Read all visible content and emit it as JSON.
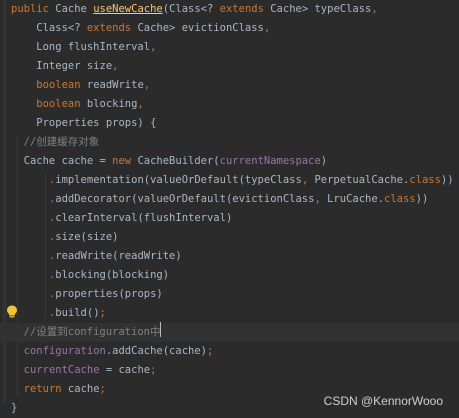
{
  "code": {
    "lines": [
      [
        {
          "t": "public ",
          "c": "kw"
        },
        {
          "t": "Cache ",
          "c": "text"
        },
        {
          "t": "useNewCache",
          "c": "fn-hl"
        },
        {
          "t": "(Class<? ",
          "c": "text"
        },
        {
          "t": "extends ",
          "c": "kw"
        },
        {
          "t": "Cache> typeClass",
          "c": "text"
        },
        {
          "t": ",",
          "c": "kw"
        }
      ],
      [
        {
          "t": "    Class<? ",
          "c": "text"
        },
        {
          "t": "extends ",
          "c": "kw"
        },
        {
          "t": "Cache> evictionClass",
          "c": "text"
        },
        {
          "t": ",",
          "c": "kw"
        }
      ],
      [
        {
          "t": "    Long flushInterval",
          "c": "text"
        },
        {
          "t": ",",
          "c": "kw"
        }
      ],
      [
        {
          "t": "    Integer size",
          "c": "text"
        },
        {
          "t": ",",
          "c": "kw"
        }
      ],
      [
        {
          "t": "    ",
          "c": "text"
        },
        {
          "t": "boolean ",
          "c": "kw"
        },
        {
          "t": "readWrite",
          "c": "text"
        },
        {
          "t": ",",
          "c": "kw"
        }
      ],
      [
        {
          "t": "    ",
          "c": "text"
        },
        {
          "t": "boolean ",
          "c": "kw"
        },
        {
          "t": "blocking",
          "c": "text"
        },
        {
          "t": ",",
          "c": "kw"
        }
      ],
      [
        {
          "t": "    Properties props) {",
          "c": "text"
        }
      ],
      [
        {
          "t": "  //创建缓存对象",
          "c": "comment"
        }
      ],
      [
        {
          "t": "  Cache cache = ",
          "c": "text"
        },
        {
          "t": "new ",
          "c": "kw"
        },
        {
          "t": "CacheBuilder(",
          "c": "text"
        },
        {
          "t": "currentNamespace",
          "c": "field"
        },
        {
          "t": ")",
          "c": "text"
        }
      ],
      [
        {
          "t": "      ",
          "c": "text"
        },
        {
          "t": ".",
          "c": "dot"
        },
        {
          "t": "implementation(valueOrDefault(typeClass",
          "c": "text"
        },
        {
          "t": ", ",
          "c": "kw"
        },
        {
          "t": "PerpetualCache.",
          "c": "text"
        },
        {
          "t": "class",
          "c": "kw"
        },
        {
          "t": "))",
          "c": "text"
        }
      ],
      [
        {
          "t": "      ",
          "c": "text"
        },
        {
          "t": ".",
          "c": "dot"
        },
        {
          "t": "addDecorator(valueOrDefault(evictionClass",
          "c": "text"
        },
        {
          "t": ", ",
          "c": "kw"
        },
        {
          "t": "LruCache.",
          "c": "text"
        },
        {
          "t": "class",
          "c": "kw"
        },
        {
          "t": "))",
          "c": "text"
        }
      ],
      [
        {
          "t": "      ",
          "c": "text"
        },
        {
          "t": ".",
          "c": "dot"
        },
        {
          "t": "clearInterval(flushInterval)",
          "c": "text"
        }
      ],
      [
        {
          "t": "      ",
          "c": "text"
        },
        {
          "t": ".",
          "c": "dot"
        },
        {
          "t": "size(size)",
          "c": "text"
        }
      ],
      [
        {
          "t": "      ",
          "c": "text"
        },
        {
          "t": ".",
          "c": "dot"
        },
        {
          "t": "readWrite(readWrite)",
          "c": "text"
        }
      ],
      [
        {
          "t": "      ",
          "c": "text"
        },
        {
          "t": ".",
          "c": "dot"
        },
        {
          "t": "blocking(blocking)",
          "c": "text"
        }
      ],
      [
        {
          "t": "      ",
          "c": "text"
        },
        {
          "t": ".",
          "c": "dot"
        },
        {
          "t": "properties(props)",
          "c": "text"
        }
      ],
      [
        {
          "t": "      ",
          "c": "text"
        },
        {
          "t": ".",
          "c": "dot"
        },
        {
          "t": "build()",
          "c": "text"
        },
        {
          "t": ";",
          "c": "kw"
        }
      ],
      [
        {
          "t": "  //设置到configuration中",
          "c": "comment"
        }
      ],
      [
        {
          "t": "  ",
          "c": "text"
        },
        {
          "t": "configuration",
          "c": "field"
        },
        {
          "t": ".addCache(cache)",
          "c": "text"
        },
        {
          "t": ";",
          "c": "kw"
        }
      ],
      [
        {
          "t": "  ",
          "c": "text"
        },
        {
          "t": "currentCache ",
          "c": "field"
        },
        {
          "t": "= cache",
          "c": "text"
        },
        {
          "t": ";",
          "c": "kw"
        }
      ],
      [
        {
          "t": "  ",
          "c": "text"
        },
        {
          "t": "return ",
          "c": "kw"
        },
        {
          "t": "cache",
          "c": "text"
        },
        {
          "t": ";",
          "c": "kw"
        }
      ],
      [
        {
          "t": "}",
          "c": "text"
        }
      ]
    ]
  },
  "watermark": "CSDN @KennorWooo",
  "icons": {
    "intention": "lightbulb-icon"
  },
  "colors": {
    "background": "#2b2b2b",
    "keyword": "#cc7832",
    "method": "#ffc66d",
    "field": "#9876aa",
    "comment": "#808080",
    "text": "#a9b7c6"
  }
}
